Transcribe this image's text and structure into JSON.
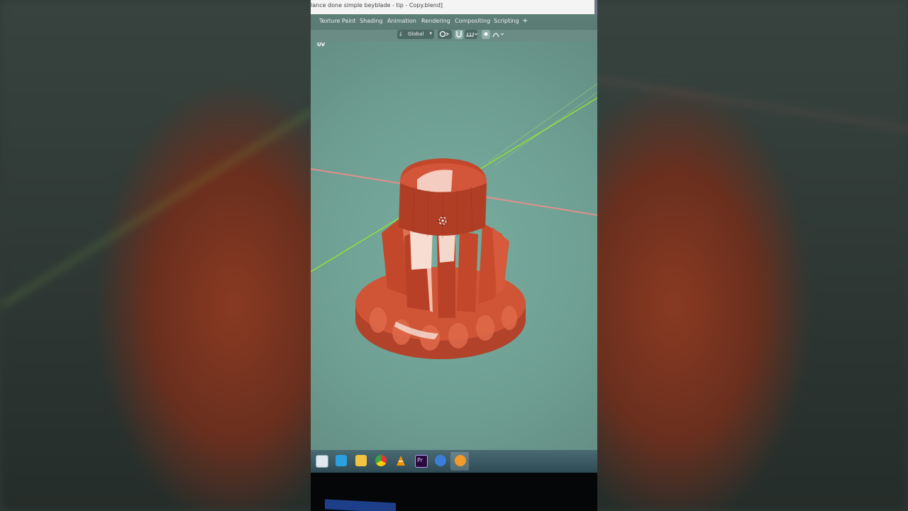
{
  "window": {
    "title": "lance done simple beyblade - tip - Copy.blend]"
  },
  "workspace_tabs": [
    "Texture Paint",
    "Shading",
    "Animation",
    "Rendering",
    "Compositing",
    "Scripting"
  ],
  "workspace_add": "+",
  "header": {
    "orientation_label": "Global",
    "orientation_icon": "⸸",
    "chevron": "▾"
  },
  "viewport": {
    "mode_label": "UV"
  },
  "taskbar": {
    "icons": [
      "task-view-icon",
      "mail-icon",
      "file-explorer-icon",
      "chrome-icon",
      "vlc-icon",
      "premiere-icon",
      "app-icon",
      "blender-icon"
    ]
  },
  "colors": {
    "viewport_bg": "#6f9f93",
    "object": "#c8492c",
    "x_axis": "#e0908c",
    "y_axis": "#8fdd3c"
  }
}
